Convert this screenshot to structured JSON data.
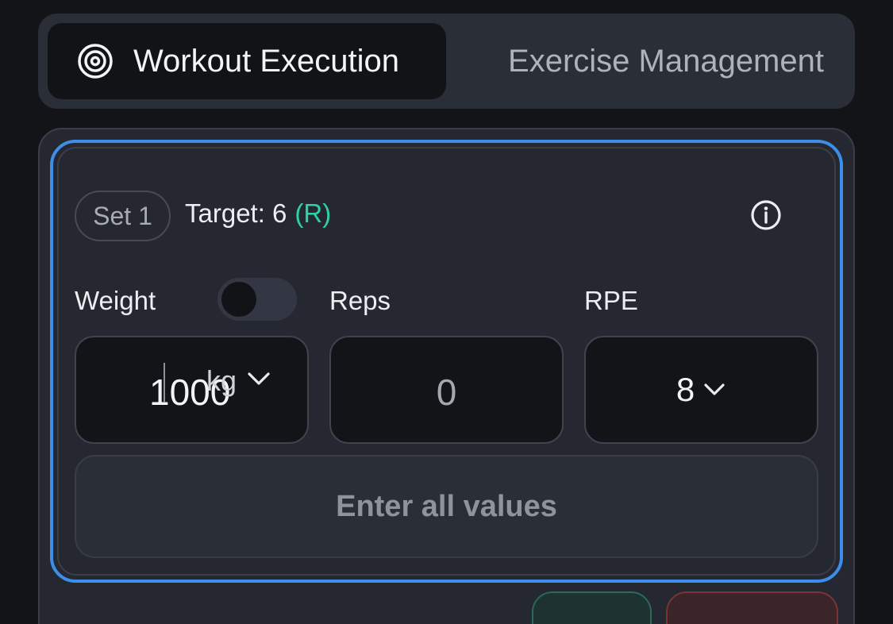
{
  "tabs": {
    "active": {
      "label": "Workout Execution",
      "icon": "target-icon"
    },
    "inactive": {
      "label": "Exercise Management"
    }
  },
  "set": {
    "badge": "Set 1",
    "target_label": "Target: 6",
    "target_suffix": "(R)",
    "info_icon": "info-icon"
  },
  "fields": {
    "weight": {
      "label": "Weight",
      "value": "1000",
      "unit": "kg",
      "unit_toggle_on": false
    },
    "reps": {
      "label": "Reps",
      "value": "0"
    },
    "rpe": {
      "label": "RPE",
      "value": "8"
    }
  },
  "submit_label": "Enter all values",
  "colors": {
    "focus_border": "#3d8ee8",
    "target_accent": "#2fd2a0",
    "confirm_button": "#2a6a56",
    "delete_button": "#7a3336"
  }
}
